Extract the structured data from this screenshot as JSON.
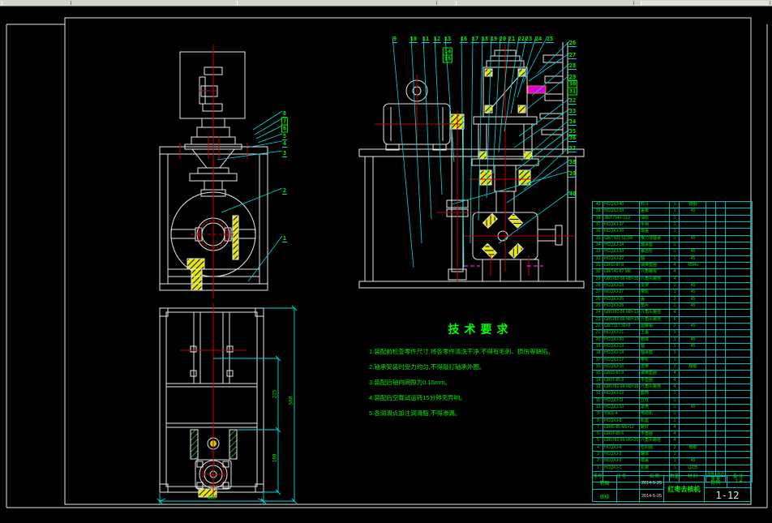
{
  "title_block": {
    "drawn_label": "制图",
    "checked_label": "审核",
    "date1": "2014-5-25",
    "date2": "2014-5-25",
    "title": "红枣去核机",
    "scale_label": "比例",
    "scale_value": "1:4",
    "sheet": "1-12"
  },
  "tech_requirements": {
    "title": "技术要求",
    "items": [
      "1.装配前检查零件尺寸,将各零件清洗干净,不得有毛刺、损伤等缺陷。",
      "2.轴承安装时受力均匀,不得敲打轴承外圈。",
      "3.装配后轴向间隙为0.15mm。",
      "4.装配后空载试运转15分钟无异响。",
      "5.各润滑点加注润滑脂,不得渗漏。"
    ]
  },
  "dimensions": {
    "plan_width": "400",
    "plan_height_overall": "560",
    "plan_seg_upper": "225",
    "plan_seg_lower": "160"
  },
  "callouts": {
    "front_stack": [
      "8",
      "7",
      "6",
      "5",
      "4"
    ],
    "front_rest": [
      "3",
      "2",
      "1"
    ],
    "side_top": [
      "9",
      "10",
      "11",
      "12",
      "13",
      "16",
      "17",
      "18",
      "19",
      "20",
      "21",
      "22",
      "23",
      "24",
      "25"
    ],
    "side_top_boxed": [
      "14",
      "15"
    ],
    "side_right": [
      "26",
      "27",
      "28",
      "29",
      "32",
      "33",
      "34",
      "35",
      "36",
      "37",
      "38",
      "39",
      "40"
    ],
    "side_right_boxed": [
      "30",
      "31"
    ]
  },
  "parts_table": {
    "header": {
      "no": "序号",
      "code": "代 号",
      "name": "名 称",
      "qty": "数量",
      "mat": "材 料",
      "w1": "单件",
      "w2": "总计",
      "weight": "重 量",
      "note": "备 注"
    },
    "rows": [
      {
        "no": "40",
        "code": "HCQXJ-40",
        "name": "料斗",
        "qty": "1",
        "mat": "铸钢"
      },
      {
        "no": "39",
        "code": "HCQXJ-39",
        "name": "盖板",
        "qty": "1",
        "mat": "45"
      },
      {
        "no": "38",
        "code": "JB/T7940-91U",
        "name": "油标",
        "qty": "1",
        "mat": ""
      },
      {
        "no": "37",
        "code": "HCQXJ-37",
        "name": "手柄",
        "qty": "1",
        "mat": ""
      },
      {
        "no": "36",
        "code": "HCQXJ-36",
        "name": "端盖",
        "qty": "1",
        "mat": ""
      },
      {
        "no": "35",
        "code": "GB/T301 51200",
        "name": "推力球轴承",
        "qty": "1",
        "mat": "45"
      },
      {
        "no": "34",
        "code": "HCQXJ-34",
        "name": "轴承座",
        "qty": "1",
        "mat": ""
      },
      {
        "no": "33",
        "code": "HCQXJ-33",
        "name": "锥齿轮",
        "qty": "1",
        "mat": "45"
      },
      {
        "no": "32",
        "code": "HCQXJ-32",
        "name": "轴",
        "qty": "1",
        "mat": "45"
      },
      {
        "no": "31",
        "code": "GB93-87 8",
        "name": "弹簧垫圈",
        "qty": "4",
        "mat": "65Mn"
      },
      {
        "no": "30",
        "code": "GB/T41-87 M8",
        "name": "六角螺母",
        "qty": "4",
        "mat": ""
      },
      {
        "no": "29",
        "code": "GB5782-86 M8×35",
        "name": "六角头螺栓",
        "qty": "4",
        "mat": ""
      },
      {
        "no": "28",
        "code": "HCQXJ-28",
        "name": "支架",
        "qty": "1",
        "mat": "45"
      },
      {
        "no": "27",
        "code": "HCQXJ-27",
        "name": "带轮",
        "qty": "1",
        "mat": "45"
      },
      {
        "no": "26",
        "code": "HCQXJ-26",
        "name": "盖",
        "qty": "2",
        "mat": "45"
      },
      {
        "no": "25",
        "code": "HCQXJ-25",
        "name": "垫片",
        "qty": "1",
        "mat": "45"
      },
      {
        "no": "24",
        "code": "GB5782-86 M8×120",
        "name": "六角头螺栓",
        "qty": "4",
        "mat": ""
      },
      {
        "no": "23",
        "code": "GB5782-86 M8×100",
        "name": "六角头螺栓",
        "qty": "6",
        "mat": ""
      },
      {
        "no": "22",
        "code": "GB/T117 30×8",
        "name": "圆锥销",
        "qty": "2",
        "mat": "45"
      },
      {
        "no": "21",
        "code": "HCQXJ-21",
        "name": "上盖",
        "qty": "1",
        "mat": ""
      },
      {
        "no": "20",
        "code": "HCQXJ-20",
        "name": "箱体",
        "qty": "1",
        "mat": "45"
      },
      {
        "no": "19",
        "code": "HCQXJ-19",
        "name": "轴",
        "qty": "1",
        "mat": "45"
      },
      {
        "no": "18",
        "code": "HCQXJ-18",
        "name": "轴承套",
        "qty": "1",
        "mat": ""
      },
      {
        "no": "17",
        "code": "HCQXJ-17",
        "name": "带轮",
        "qty": "1",
        "mat": ""
      },
      {
        "no": "16",
        "code": "HCQXJ-16",
        "name": "皮带",
        "qty": "2",
        "mat": "橡胶"
      },
      {
        "no": "15",
        "code": "GB93-87 8",
        "name": "弹簧垫圈",
        "qty": "4",
        "mat": ""
      },
      {
        "no": "14",
        "code": "GB97-85 8",
        "name": "平垫圈",
        "qty": "4",
        "mat": ""
      },
      {
        "no": "13",
        "code": "GB5782-86 M8×16",
        "name": "六角头螺栓",
        "qty": "4",
        "mat": ""
      },
      {
        "no": "12",
        "code": "HCQXJ-12",
        "name": "套筒",
        "qty": "1",
        "mat": ""
      },
      {
        "no": "11",
        "code": "HCQXJ-11",
        "name": "立柱",
        "qty": "1",
        "mat": ""
      },
      {
        "no": "10",
        "code": "HCQXJ-10",
        "name": "罩壳",
        "qty": "1",
        "mat": "45"
      },
      {
        "no": "9",
        "code": "Y90S-4",
        "name": "电动机",
        "qty": "1",
        "mat": ""
      },
      {
        "no": "8",
        "code": "HCQXJ-8",
        "name": "机座",
        "qty": "1",
        "mat": ""
      },
      {
        "no": "7",
        "code": "GB85-85 M6×12",
        "name": "螺钉",
        "qty": "4",
        "mat": ""
      },
      {
        "no": "6",
        "code": "GB97-85 6",
        "name": "平垫圈",
        "qty": "4",
        "mat": ""
      },
      {
        "no": "5",
        "code": "GB5782-86 M6×20",
        "name": "六角头螺栓",
        "qty": "4",
        "mat": ""
      },
      {
        "no": "4",
        "code": "HCQXJ-4",
        "name": "密封圈",
        "qty": "3",
        "mat": "橡胶"
      },
      {
        "no": "3",
        "code": "HCQXJ-3",
        "name": "罐体",
        "qty": "1",
        "mat": ""
      },
      {
        "no": "2",
        "code": "HCQXJ-2",
        "name": "端盖",
        "qty": "1",
        "mat": "45"
      },
      {
        "no": "1",
        "code": "HCQXJ-1",
        "name": "机架",
        "qty": "1",
        "mat": "Q235"
      }
    ]
  },
  "colors": {
    "line": "#e8e8e8",
    "centerline": "#c80000",
    "annotation": "#00dcdc",
    "text_green": "#00ee00",
    "hatch_yellow": "#e6e600",
    "magenta": "#dd00dd"
  }
}
